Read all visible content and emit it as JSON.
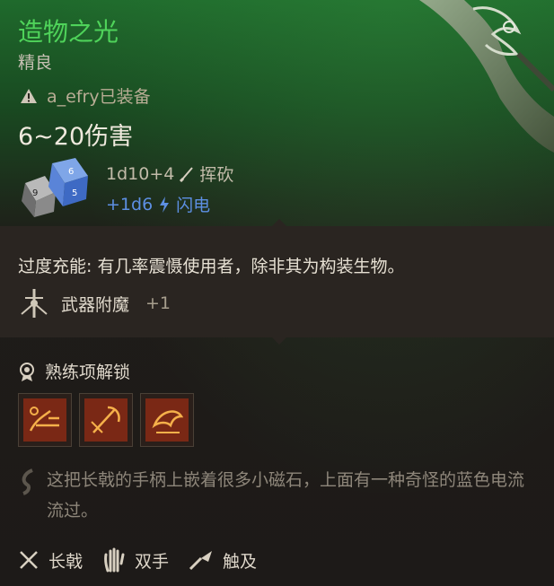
{
  "item": {
    "name": "造物之光",
    "rarity": "精良",
    "equipped_by": "a_efry已装备",
    "damage": "6~20伤害",
    "roll_primary": {
      "dice": "1d10+4",
      "type": "挥砍"
    },
    "roll_secondary": {
      "dice": "+1d6",
      "type": "闪电"
    }
  },
  "passive": {
    "text": "过度充能: 有几率震慑使用者，除非其为构装生物。"
  },
  "enchantment": {
    "label": "武器附魔",
    "value": "+1"
  },
  "proficiency": {
    "label": "熟练项解锁",
    "skills": [
      "skill-1",
      "skill-2",
      "skill-3"
    ]
  },
  "lore": {
    "text": "这把长戟的手柄上嵌着很多小磁石，上面有一种奇怪的蓝色电流流过。"
  },
  "traits": [
    {
      "label": "长戟",
      "icon": "crossed-weapons-icon"
    },
    {
      "label": "双手",
      "icon": "hand-icon"
    },
    {
      "label": "触及",
      "icon": "reach-icon"
    }
  ],
  "colors": {
    "name": "#4fd35a",
    "lightning": "#5d8fe3"
  }
}
